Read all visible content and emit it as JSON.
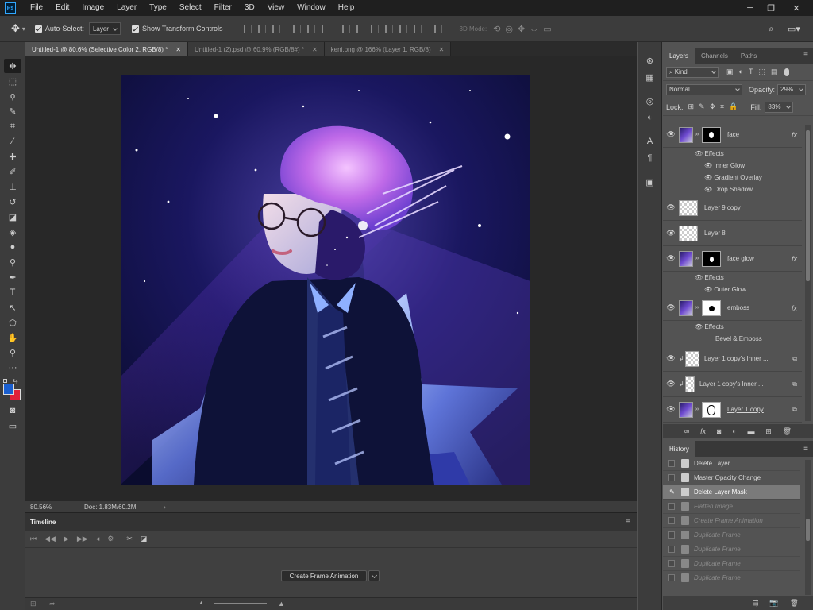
{
  "app": {
    "logo": "Ps"
  },
  "menu": [
    "File",
    "Edit",
    "Image",
    "Layer",
    "Type",
    "Select",
    "Filter",
    "3D",
    "View",
    "Window",
    "Help"
  ],
  "window_controls": {
    "minimize": "─",
    "restore": "❐",
    "close": "✕"
  },
  "options": {
    "auto_select_label": "Auto-Select:",
    "auto_select_value": "Layer",
    "transform_label": "Show Transform Controls",
    "mode_3d": "3D Mode:"
  },
  "tabs": [
    {
      "label": "Untitled-1 @ 80.6% (Selective Color 2, RGB/8) *"
    },
    {
      "label": "Untitled-1 (2).psd @ 60.9% (RGB/8#) *"
    },
    {
      "label": "keni.png @ 166% (Layer 1, RGB/8)"
    }
  ],
  "tab_close": "✕",
  "status": {
    "zoom": "80.56%",
    "doc": "Doc: 1.83M/60.2M"
  },
  "timeline": {
    "title": "Timeline",
    "button": "Create Frame Animation"
  },
  "layers_panel": {
    "tabs": [
      "Layers",
      "Channels",
      "Paths"
    ],
    "kind": "Kind",
    "blend_mode": "Normal",
    "opacity_label": "Opacity:",
    "opacity_value": "29%",
    "lock_label": "Lock:",
    "fill_label": "Fill:",
    "fill_value": "83%",
    "layers": [
      {
        "name": "face",
        "fx": "fx",
        "effects_label": "Effects",
        "effects": [
          "Inner Glow",
          "Gradient Overlay",
          "Drop Shadow"
        ]
      },
      {
        "name": "Layer 9 copy"
      },
      {
        "name": "Layer 8"
      },
      {
        "name": "face glow",
        "fx": "fx",
        "effects_label": "Effects",
        "effects": [
          "Outer Glow"
        ]
      },
      {
        "name": "emboss",
        "fx": "fx",
        "effects_label": "Effects",
        "effects": [
          "Bevel & Emboss"
        ]
      },
      {
        "name": "Layer 1 copy's Inner ..."
      },
      {
        "name": "Layer 1 copy's Inner ..."
      },
      {
        "name": "Layer 1 copy"
      }
    ]
  },
  "history_panel": {
    "title": "History",
    "items": [
      {
        "label": "Delete Layer",
        "state": "active"
      },
      {
        "label": "Master Opacity Change",
        "state": "active"
      },
      {
        "label": "Delete Layer Mask",
        "state": "current"
      },
      {
        "label": "Flatten Image",
        "state": "undone"
      },
      {
        "label": "Create Frame Animation",
        "state": "undone"
      },
      {
        "label": "Duplicate Frame",
        "state": "undone"
      },
      {
        "label": "Duplicate Frame",
        "state": "undone"
      },
      {
        "label": "Duplicate Frame",
        "state": "undone"
      },
      {
        "label": "Duplicate Frame",
        "state": "undone"
      }
    ]
  },
  "colors": {
    "foreground": "#1a5fd0",
    "background": "#e0203a"
  }
}
